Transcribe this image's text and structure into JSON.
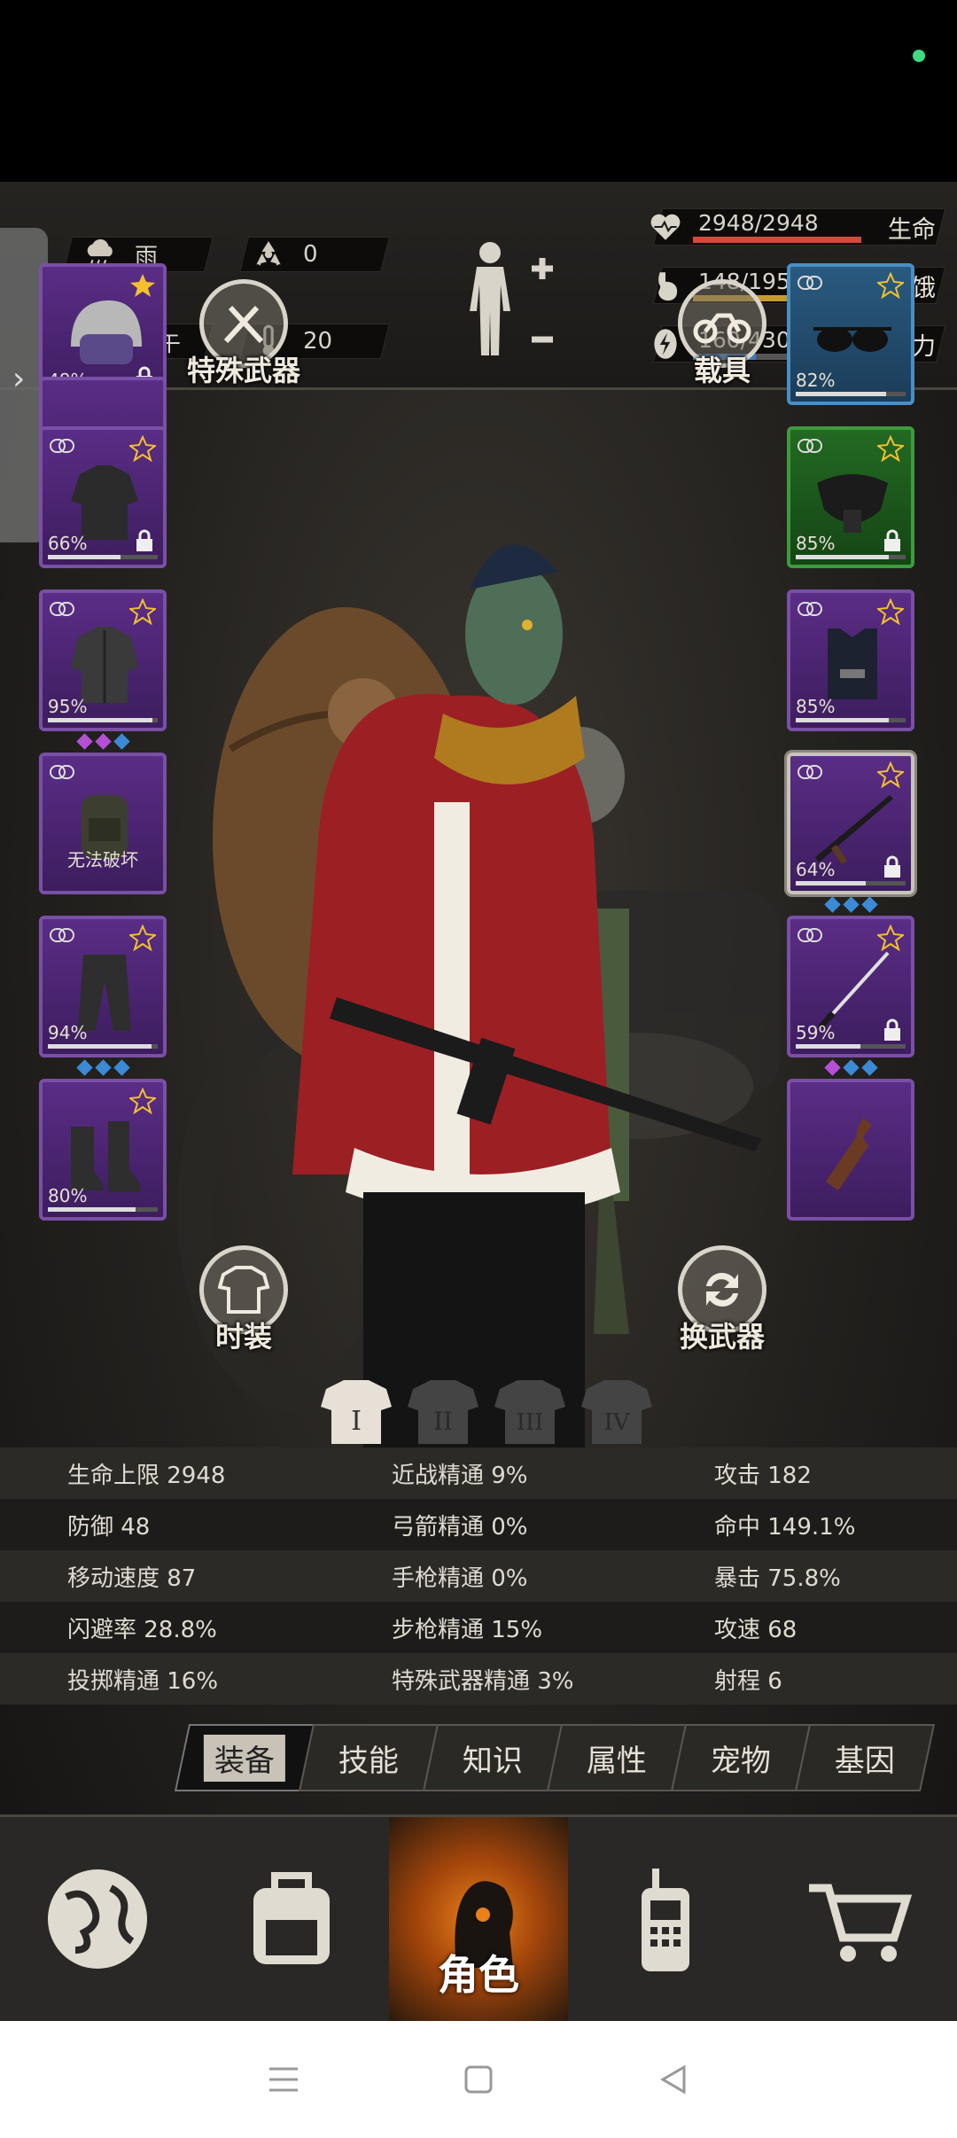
{
  "top_stats": {
    "weather": "雨",
    "radiation": "0",
    "time_of_day": "下午",
    "temperature": "20"
  },
  "bars": [
    {
      "value": "2948/2948",
      "label": "生命",
      "fill": 1.0,
      "color": "#d44a3a"
    },
    {
      "value": "148/195",
      "label": "饥饿",
      "fill": 0.759,
      "color": "#c79a2e"
    },
    {
      "value": "160/430",
      "label": "精力",
      "fill": 0.372,
      "color": "#3a7ac4"
    }
  ],
  "left_slots": [
    {
      "name": "helmet",
      "percent": "48%",
      "durability": 0.48,
      "gems": [
        "#3a8ad6",
        "#3a8ad6",
        "#3a8ad6"
      ]
    },
    {
      "name": "shirt",
      "percent": "66%",
      "durability": 0.66,
      "gems": []
    },
    {
      "name": "jacket",
      "percent": "95%",
      "durability": 0.95,
      "gems": [
        "#b44fd6",
        "#b44fd6",
        "#3a8ad6"
      ]
    },
    {
      "name": "backpack",
      "status": "无法破坏"
    },
    {
      "name": "pants",
      "percent": "94%",
      "durability": 0.94,
      "gems": [
        "#3a8ad6",
        "#3a8ad6",
        "#3a8ad6"
      ]
    },
    {
      "name": "boots",
      "percent": "80%",
      "durability": 0.8,
      "gems": []
    }
  ],
  "right_slots": [
    {
      "name": "glasses",
      "percent": "82%",
      "durability": 0.82
    },
    {
      "name": "mask",
      "percent": "85%",
      "durability": 0.85
    },
    {
      "name": "vest",
      "percent": "85%",
      "durability": 0.85
    },
    {
      "name": "rifle",
      "percent": "64%",
      "durability": 0.64,
      "gems": [
        "#3a8ad6",
        "#3a8ad6",
        "#3a8ad6"
      ]
    },
    {
      "name": "katana",
      "percent": "59%",
      "durability": 0.59,
      "gems": [
        "#b44fd6",
        "#3a8ad6",
        "#3a8ad6"
      ]
    },
    {
      "name": "molotov"
    }
  ],
  "actions": {
    "special_weapon": "特殊武器",
    "vehicle": "载具",
    "fashion": "时装",
    "swap_weapon": "换武器"
  },
  "stats": [
    [
      "生命上限 2948",
      "近战精通 9%",
      "攻击 182"
    ],
    [
      "防御 48",
      "弓箭精通 0%",
      "命中 149.1%"
    ],
    [
      "移动速度 87",
      "手枪精通 0%",
      "暴击 75.8%"
    ],
    [
      "闪避率 28.8%",
      "步枪精通 15%",
      "攻速 68"
    ],
    [
      "投掷精通 16%",
      "特殊武器精通 3%",
      "射程 6"
    ]
  ],
  "tabs": [
    "装备",
    "技能",
    "知识",
    "属性",
    "宠物",
    "基因"
  ],
  "bottom_nav": {
    "active_label": "角色"
  },
  "colors": {
    "accent": "#e8801c",
    "rare_purple": "#7a4fa6",
    "blue_slot": "#4a8fc4",
    "green_slot": "#3f9a3f"
  }
}
